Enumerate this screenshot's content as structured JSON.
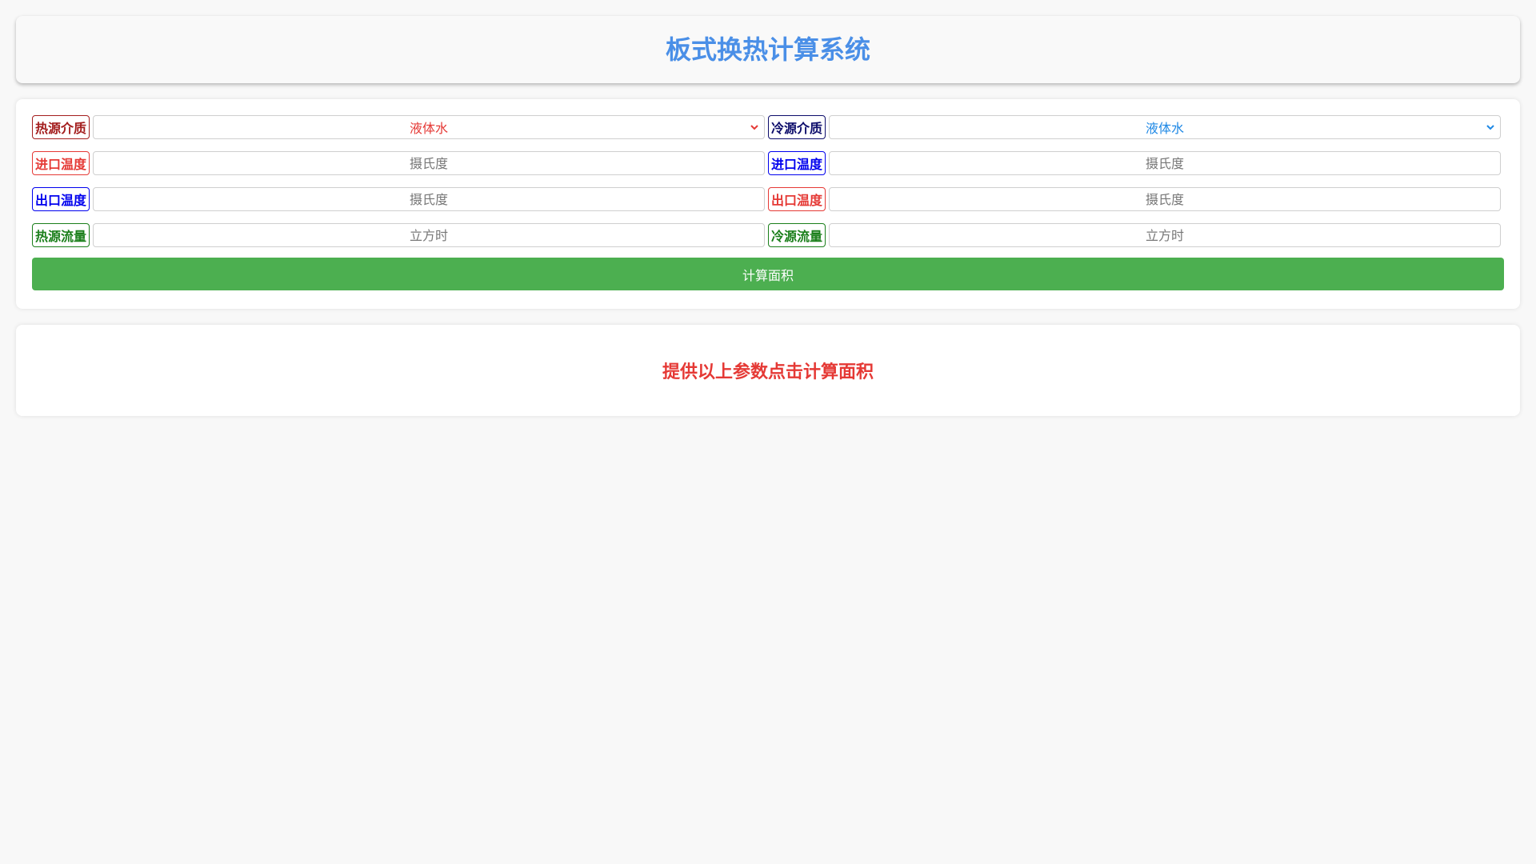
{
  "header": {
    "title": "板式换热计算系统"
  },
  "colors": {
    "title": "#4a8fe7",
    "dark_red": "#a31d1d",
    "red": "#e53935",
    "dark_navy": "#0d0d6b",
    "blue": "#0000ee",
    "green": "#1a7f1a",
    "button": "#4caf50",
    "select_hot_text": "#e53935",
    "select_cold_text": "#1e88e5"
  },
  "form": {
    "hot": {
      "medium_label": "热源介质",
      "medium_value": "液体水",
      "inlet_label": "进口温度",
      "inlet_placeholder": "摄氏度",
      "outlet_label": "出口温度",
      "outlet_placeholder": "摄氏度",
      "flow_label": "热源流量",
      "flow_placeholder": "立方时"
    },
    "cold": {
      "medium_label": "冷源介质",
      "medium_value": "液体水",
      "inlet_label": "进口温度",
      "inlet_placeholder": "摄氏度",
      "outlet_label": "出口温度",
      "outlet_placeholder": "摄氏度",
      "flow_label": "冷源流量",
      "flow_placeholder": "立方时"
    },
    "calculate_button": "计算面积"
  },
  "result": {
    "message": "提供以上参数点击计算面积"
  }
}
